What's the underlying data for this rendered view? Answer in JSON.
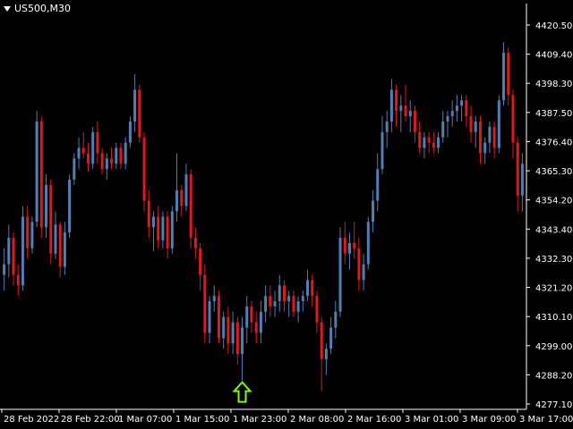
{
  "header": {
    "symbol_timeframe": "US500,M30"
  },
  "colors": {
    "background": "#000000",
    "bull_candle": "#4f7fb3",
    "bear_candle": "#e0191c",
    "axis_text": "#ffffff",
    "axis_line": "#ffffff",
    "signal_arrow": "#7cfc00"
  },
  "icons": {
    "signal": "up-arrow-icon",
    "menu": "triangle-down-icon"
  },
  "chart_data": {
    "type": "candlestick",
    "price_axis": {
      "ticks": [
        "4420.50",
        "4409.40",
        "4398.30",
        "4387.50",
        "4376.40",
        "4365.30",
        "4354.20",
        "4343.40",
        "4332.30",
        "4321.20",
        "4310.10",
        "4299.00",
        "4288.20",
        "4277.10"
      ],
      "range": [
        4277.1,
        4420.5
      ]
    },
    "time_axis": {
      "ticks": [
        "28 Feb 2022",
        "28 Feb 22:00",
        "1 Mar 07:00",
        "1 Mar 15:00",
        "1 Mar 23:00",
        "2 Mar 08:00",
        "2 Mar 16:00",
        "3 Mar 01:00",
        "3 Mar 09:00",
        "3 Mar 17:00"
      ]
    },
    "signal": {
      "direction": "up",
      "candle_index": 51
    },
    "candles": [
      [
        4326,
        4336,
        4320,
        4330
      ],
      [
        4330,
        4345,
        4325,
        4340
      ],
      [
        4340,
        4342,
        4322,
        4326
      ],
      [
        4326,
        4330,
        4318,
        4322
      ],
      [
        4322,
        4352,
        4320,
        4348
      ],
      [
        4348,
        4352,
        4332,
        4336
      ],
      [
        4336,
        4348,
        4334,
        4346
      ],
      [
        4346,
        4388,
        4344,
        4384
      ],
      [
        4384,
        4386,
        4340,
        4344
      ],
      [
        4344,
        4364,
        4340,
        4360
      ],
      [
        4360,
        4362,
        4330,
        4334
      ],
      [
        4334,
        4350,
        4332,
        4345
      ],
      [
        4345,
        4346,
        4325,
        4329
      ],
      [
        4329,
        4346,
        4326,
        4342
      ],
      [
        4342,
        4364,
        4340,
        4362
      ],
      [
        4362,
        4372,
        4360,
        4370
      ],
      [
        4370,
        4378,
        4366,
        4374
      ],
      [
        4374,
        4380,
        4370,
        4372
      ],
      [
        4372,
        4376,
        4365,
        4368
      ],
      [
        4368,
        4382,
        4366,
        4380
      ],
      [
        4380,
        4384,
        4368,
        4372
      ],
      [
        4372,
        4374,
        4364,
        4366
      ],
      [
        4366,
        4372,
        4362,
        4370
      ],
      [
        4370,
        4374,
        4366,
        4368
      ],
      [
        4368,
        4376,
        4366,
        4374
      ],
      [
        4374,
        4376,
        4366,
        4368
      ],
      [
        4368,
        4378,
        4366,
        4376
      ],
      [
        4376,
        4386,
        4374,
        4384
      ],
      [
        4384,
        4402,
        4380,
        4396
      ],
      [
        4396,
        4398,
        4376,
        4378
      ],
      [
        4378,
        4380,
        4350,
        4354
      ],
      [
        4354,
        4358,
        4340,
        4344
      ],
      [
        4344,
        4350,
        4335,
        4348
      ],
      [
        4348,
        4352,
        4336,
        4339
      ],
      [
        4339,
        4350,
        4336,
        4348
      ],
      [
        4348,
        4350,
        4332,
        4336
      ],
      [
        4336,
        4352,
        4334,
        4350
      ],
      [
        4350,
        4372,
        4346,
        4358
      ],
      [
        4358,
        4360,
        4348,
        4352
      ],
      [
        4352,
        4368,
        4350,
        4364
      ],
      [
        4364,
        4366,
        4336,
        4340
      ],
      [
        4340,
        4344,
        4332,
        4336
      ],
      [
        4336,
        4338,
        4320,
        4326
      ],
      [
        4326,
        4330,
        4300,
        4304
      ],
      [
        4304,
        4318,
        4300,
        4316
      ],
      [
        4316,
        4322,
        4312,
        4318
      ],
      [
        4318,
        4320,
        4300,
        4302
      ],
      [
        4302,
        4312,
        4298,
        4310
      ],
      [
        4310,
        4314,
        4296,
        4300
      ],
      [
        4300,
        4312,
        4296,
        4308
      ],
      [
        4308,
        4310,
        4292,
        4296
      ],
      [
        4296,
        4310,
        4286,
        4306
      ],
      [
        4306,
        4318,
        4300,
        4314
      ],
      [
        4314,
        4316,
        4304,
        4308
      ],
      [
        4308,
        4312,
        4300,
        4304
      ],
      [
        4304,
        4316,
        4300,
        4312
      ],
      [
        4312,
        4322,
        4308,
        4318
      ],
      [
        4318,
        4322,
        4310,
        4314
      ],
      [
        4314,
        4320,
        4310,
        4316
      ],
      [
        4316,
        4326,
        4312,
        4322
      ],
      [
        4322,
        4324,
        4312,
        4316
      ],
      [
        4316,
        4320,
        4310,
        4318
      ],
      [
        4318,
        4320,
        4310,
        4312
      ],
      [
        4312,
        4318,
        4308,
        4316
      ],
      [
        4316,
        4320,
        4312,
        4318
      ],
      [
        4318,
        4328,
        4316,
        4324
      ],
      [
        4324,
        4326,
        4314,
        4318
      ],
      [
        4318,
        4320,
        4304,
        4308
      ],
      [
        4308,
        4310,
        4282,
        4294
      ],
      [
        4294,
        4300,
        4288,
        4298
      ],
      [
        4298,
        4310,
        4296,
        4306
      ],
      [
        4306,
        4316,
        4302,
        4312
      ],
      [
        4312,
        4344,
        4310,
        4340
      ],
      [
        4340,
        4346,
        4330,
        4334
      ],
      [
        4334,
        4342,
        4328,
        4338
      ],
      [
        4338,
        4346,
        4332,
        4336
      ],
      [
        4336,
        4340,
        4320,
        4324
      ],
      [
        4324,
        4334,
        4320,
        4330
      ],
      [
        4330,
        4348,
        4328,
        4346
      ],
      [
        4346,
        4358,
        4342,
        4354
      ],
      [
        4354,
        4372,
        4350,
        4366
      ],
      [
        4366,
        4386,
        4364,
        4380
      ],
      [
        4380,
        4388,
        4374,
        4384
      ],
      [
        4384,
        4400,
        4380,
        4396
      ],
      [
        4396,
        4398,
        4382,
        4388
      ],
      [
        4388,
        4394,
        4380,
        4390
      ],
      [
        4390,
        4398,
        4384,
        4386
      ],
      [
        4386,
        4392,
        4380,
        4388
      ],
      [
        4388,
        4390,
        4376,
        4380
      ],
      [
        4380,
        4384,
        4372,
        4374
      ],
      [
        4374,
        4380,
        4370,
        4378
      ],
      [
        4378,
        4380,
        4372,
        4376
      ],
      [
        4376,
        4380,
        4372,
        4374
      ],
      [
        4374,
        4380,
        4372,
        4378
      ],
      [
        4378,
        4388,
        4376,
        4384
      ],
      [
        4384,
        4388,
        4378,
        4386
      ],
      [
        4386,
        4392,
        4382,
        4388
      ],
      [
        4388,
        4394,
        4384,
        4390
      ],
      [
        4390,
        4394,
        4384,
        4392
      ],
      [
        4392,
        4394,
        4382,
        4386
      ],
      [
        4386,
        4390,
        4376,
        4380
      ],
      [
        4380,
        4386,
        4374,
        4384
      ],
      [
        4384,
        4386,
        4368,
        4372
      ],
      [
        4372,
        4378,
        4368,
        4376
      ],
      [
        4376,
        4384,
        4372,
        4382
      ],
      [
        4382,
        4384,
        4370,
        4374
      ],
      [
        4374,
        4394,
        4372,
        4392
      ],
      [
        4392,
        4414,
        4390,
        4410
      ],
      [
        4410,
        4412,
        4390,
        4394
      ],
      [
        4394,
        4396,
        4370,
        4376
      ],
      [
        4376,
        4378,
        4350,
        4356
      ],
      [
        4356,
        4372,
        4350,
        4368
      ]
    ]
  }
}
